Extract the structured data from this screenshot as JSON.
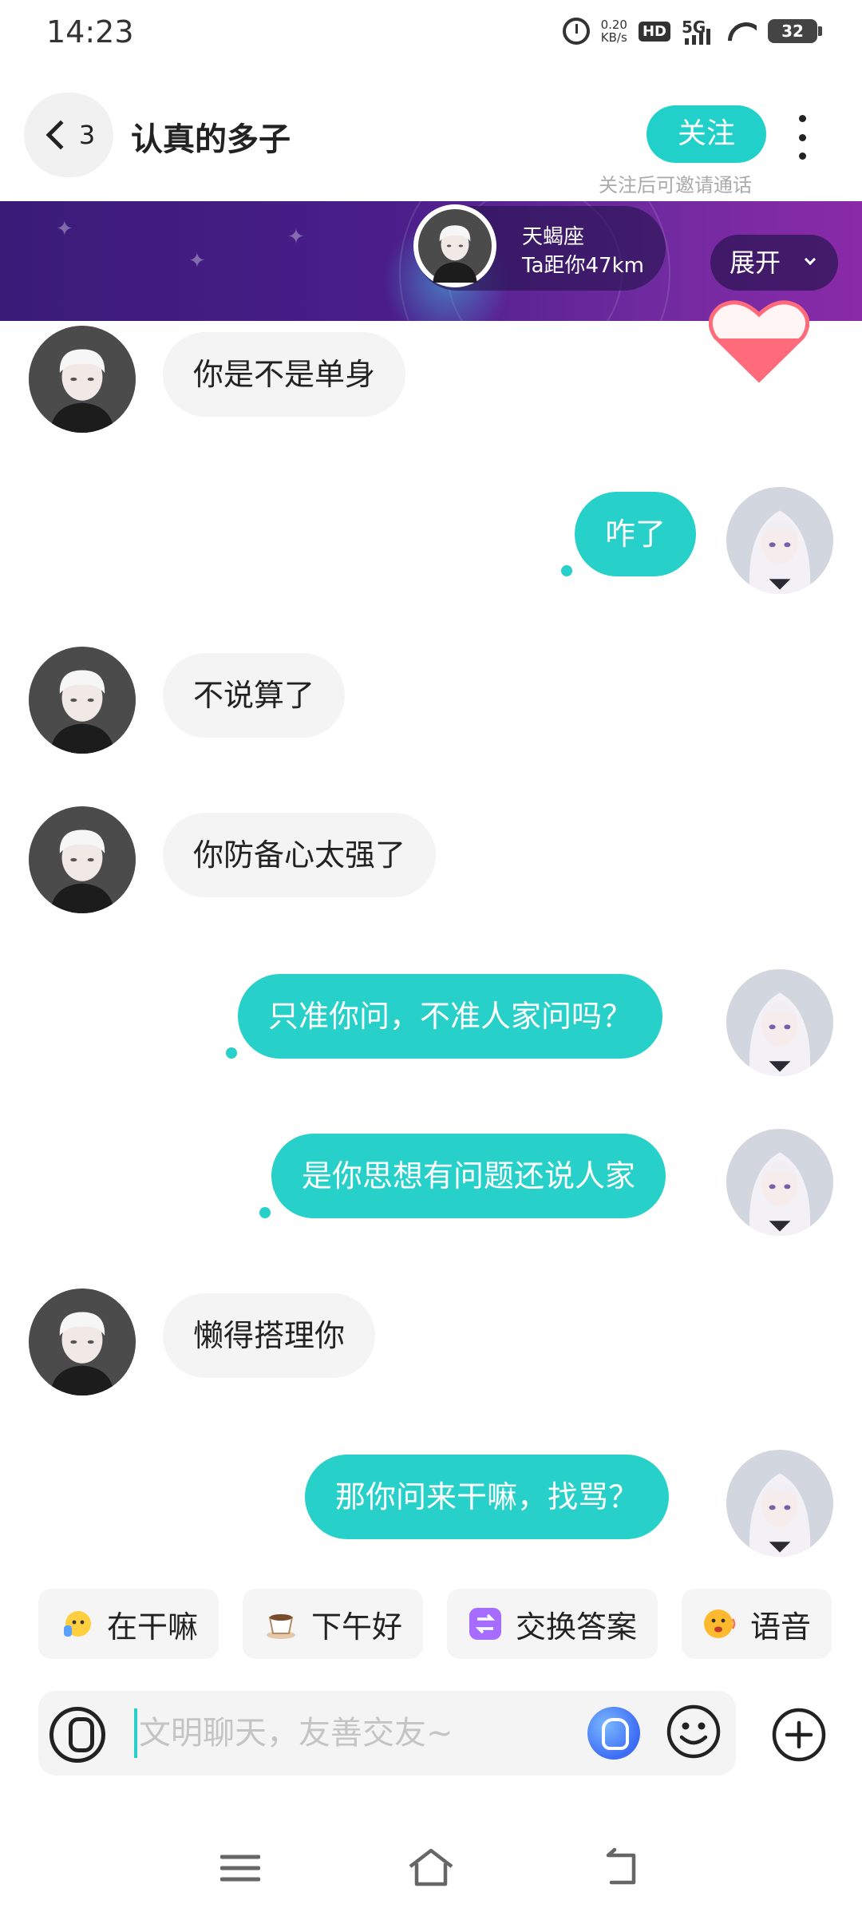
{
  "status_bar": {
    "time": "14:23",
    "net_speed_value": "0.20",
    "net_speed_unit": "KB/s",
    "hd_label": "HD",
    "network_label": "5G",
    "battery": "32",
    "icons": [
      "alarm-icon",
      "hd-icon",
      "5g-signal-icon",
      "wifi-icon",
      "battery-icon"
    ]
  },
  "header": {
    "back_count": "3",
    "title": "认真的多子",
    "follow_label": "关注",
    "follow_hint": "关注后可邀请通话",
    "more_icon": "more-vertical-icon"
  },
  "banner": {
    "zodiac": "天蝎座",
    "distance": "Ta距你47km",
    "expand_label": "展开"
  },
  "colors": {
    "accent": "#27d0c8",
    "incoming_bubble": "#f4f4f4",
    "banner_start": "#3a1b78",
    "banner_end": "#8a2aa8"
  },
  "messages": [
    {
      "side": "in",
      "text": "你是不是单身"
    },
    {
      "side": "out",
      "text": "咋了"
    },
    {
      "side": "in",
      "text": "不说算了"
    },
    {
      "side": "in",
      "text": "你防备心太强了"
    },
    {
      "side": "out",
      "text": "只准你问，不准人家问吗？"
    },
    {
      "side": "out",
      "text": "是你思想有问题还说人家"
    },
    {
      "side": "in",
      "text": "懒得搭理你"
    },
    {
      "side": "out",
      "text": "那你问来干嘛，找骂？"
    }
  ],
  "quick_replies": [
    {
      "icon": "thinking-emoji-icon",
      "label": "在干嘛"
    },
    {
      "icon": "coffee-cup-icon",
      "label": "下午好"
    },
    {
      "icon": "swap-icon",
      "label": "交换答案"
    },
    {
      "icon": "voice-emoji-icon",
      "label": "语音"
    }
  ],
  "input": {
    "placeholder": "文明聊天，友善交友~",
    "value": ""
  },
  "nav": {
    "icons": [
      "menu-icon",
      "home-icon",
      "back-icon"
    ]
  }
}
